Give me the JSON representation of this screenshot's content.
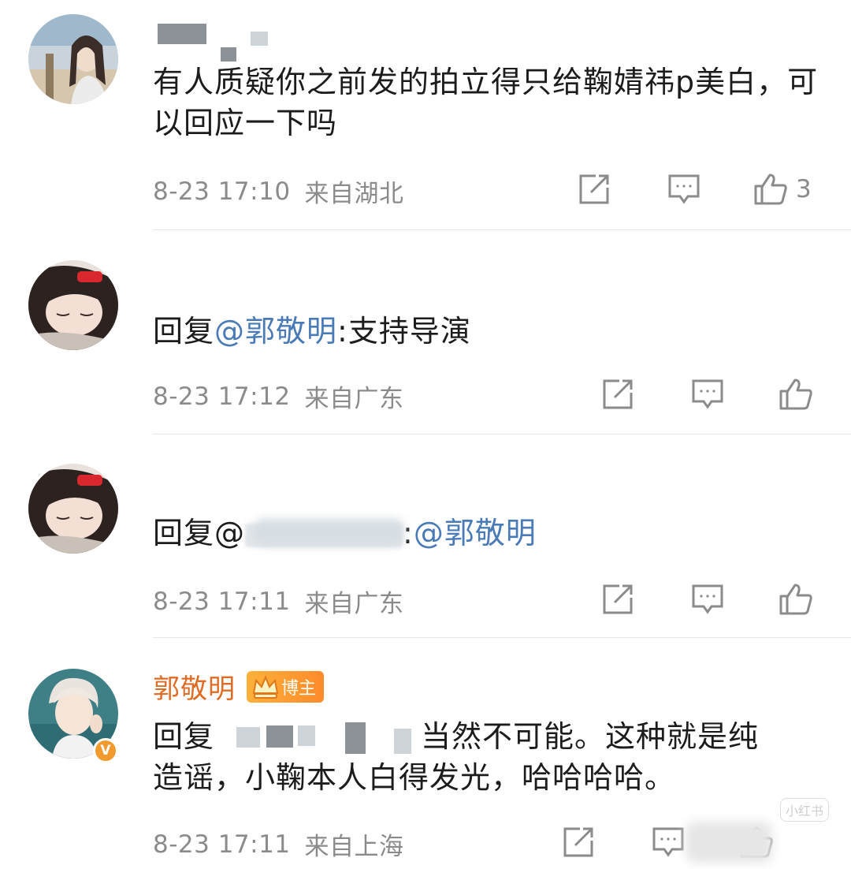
{
  "comments": [
    {
      "username": "",
      "text": "有人质疑你之前发的拍立得只给鞠婧祎p美白，可以回应一下吗",
      "time": "8-23 17:10",
      "location": "来自湖北",
      "like_count": "3"
    },
    {
      "reply_prefix": "回复",
      "mention": "@郭敬明",
      "colon": ":",
      "text": "支持导演",
      "time": "8-23 17:12",
      "location": "来自广东"
    },
    {
      "reply_prefix": "回复@",
      "colon": ":",
      "mention": "@郭敬明",
      "time": "8-23 17:11",
      "location": "来自广东"
    },
    {
      "username": "郭敬明",
      "badge": "博主",
      "verified_mark": "V",
      "reply_prefix": "回复",
      "text_line1": "当然不可能。这种就是纯",
      "text_line2": "造谣，小鞠本人白得发光，哈哈哈哈。",
      "time": "8-23 17:11",
      "location": "来自上海"
    }
  ],
  "watermark": "小红书",
  "colors": {
    "username_orange": "#e06b24",
    "mention_blue": "#4a7bb7",
    "meta_gray": "#8b8b8b",
    "text": "#1c1c1c",
    "badge_orange": "#ff9a2e",
    "verified": "#f29a2e"
  },
  "icons": {
    "share": "share-icon",
    "comment": "comment-icon",
    "like": "like-icon"
  }
}
